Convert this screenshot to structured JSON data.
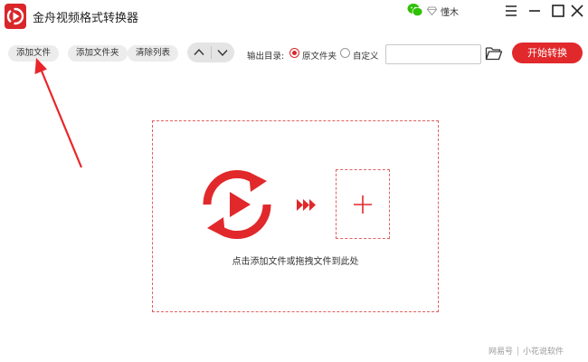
{
  "app": {
    "title": "金舟视频格式转换器",
    "user_name": "懂木",
    "brand_color": "#e1282b"
  },
  "toolbar": {
    "add_file_label": "添加文件",
    "add_folder_label": "添加文件夹",
    "clear_list_label": "清除列表",
    "output_dir_label": "输出目录:",
    "output_options": [
      {
        "label": "原文件夹",
        "selected": true
      },
      {
        "label": "自定义",
        "selected": false
      }
    ],
    "output_path_value": "",
    "start_label": "开始转换"
  },
  "dropzone": {
    "hint": "点击添加文件或拖拽文件到此处"
  },
  "watermark": {
    "source": "网易号",
    "author": "小花说软件"
  },
  "icons": {
    "logo": "app-logo-icon",
    "wechat": "wechat-icon",
    "diamond": "vip-diamond-icon",
    "menu": "menu-icon",
    "minimize": "minimize-icon",
    "maximize": "maximize-icon",
    "close": "close-icon",
    "up": "chevron-up-icon",
    "down": "chevron-down-icon",
    "folder": "folder-icon",
    "play": "play-convert-icon",
    "arrows": "triple-arrow-icon",
    "plus": "plus-icon"
  }
}
